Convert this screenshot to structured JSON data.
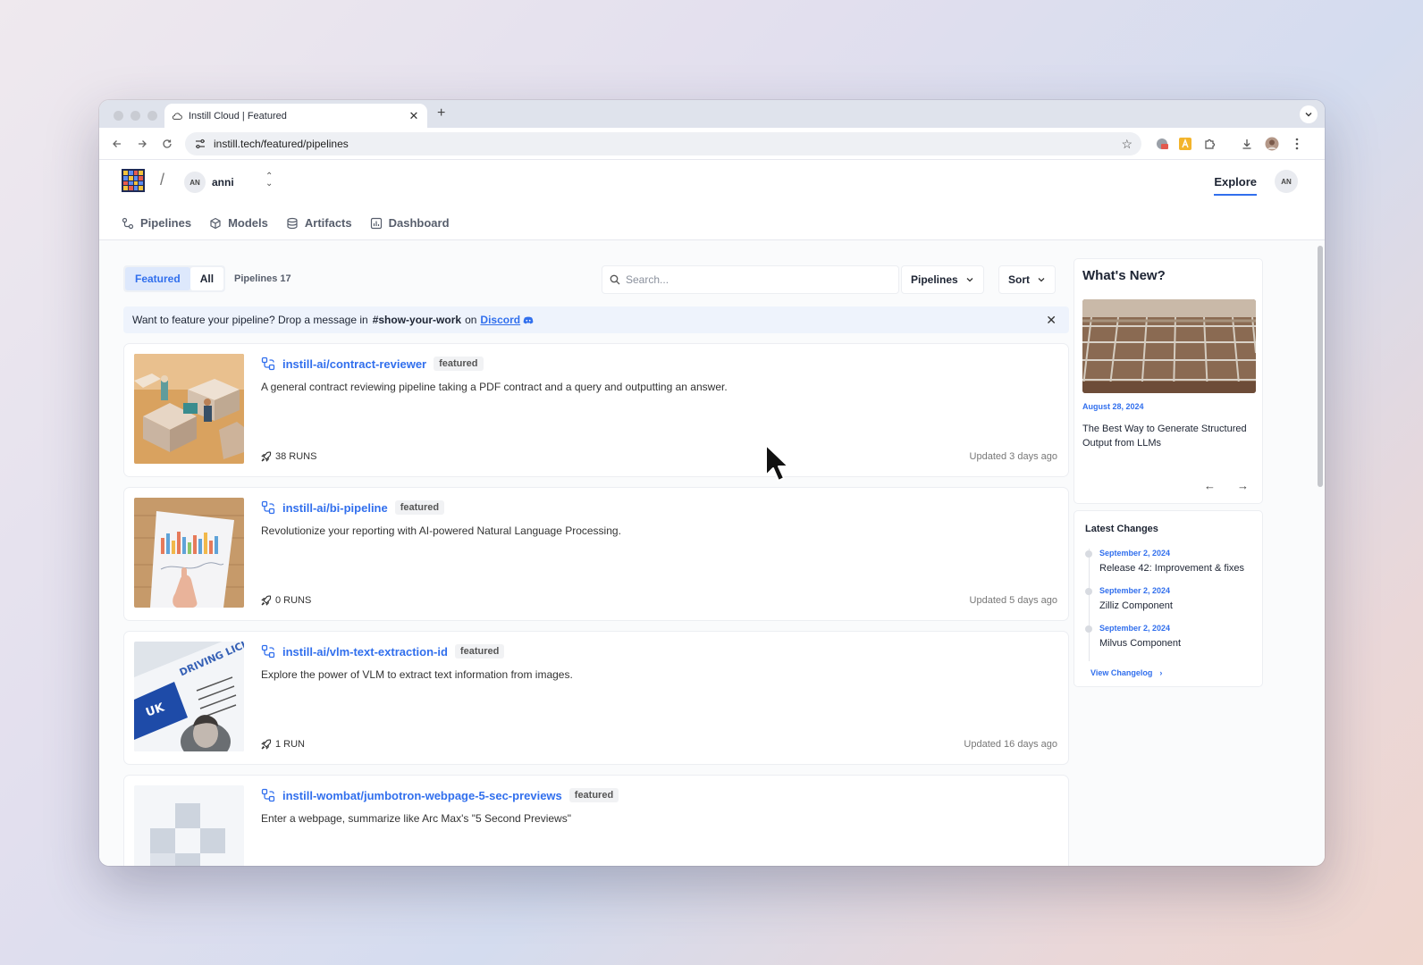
{
  "browser": {
    "tab_title": "Instill Cloud | Featured",
    "url": "instill.tech/featured/pipelines"
  },
  "header": {
    "namespace_initials": "AN",
    "namespace_name": "anni",
    "explore_label": "Explore",
    "user_initials": "AN"
  },
  "nav": {
    "pipelines": "Pipelines",
    "models": "Models",
    "artifacts": "Artifacts",
    "dashboard": "Dashboard"
  },
  "filters": {
    "featured": "Featured",
    "all": "All",
    "count_label": "Pipelines 17",
    "search_placeholder": "Search...",
    "type_dropdown": "Pipelines",
    "sort_dropdown": "Sort"
  },
  "banner": {
    "text": "Want to feature your pipeline? Drop a message in",
    "channel": "#show-your-work",
    "on": "on",
    "link": "Discord"
  },
  "pipelines": [
    {
      "name": "instill-ai/contract-reviewer",
      "badge": "featured",
      "description": "A general contract reviewing pipeline taking a PDF contract and a query and outputting an answer.",
      "runs": "38 RUNS",
      "updated": "Updated 3 days ago"
    },
    {
      "name": "instill-ai/bi-pipeline",
      "badge": "featured",
      "description": "Revolutionize your reporting with AI-powered Natural Language Processing.",
      "runs": "0 RUNS",
      "updated": "Updated 5 days ago"
    },
    {
      "name": "instill-ai/vlm-text-extraction-id",
      "badge": "featured",
      "description": "Explore the power of VLM to extract text information from images.",
      "runs": "1 RUN",
      "updated": "Updated 16 days ago"
    },
    {
      "name": "instill-wombat/jumbotron-webpage-5-sec-previews",
      "badge": "featured",
      "description": "Enter a webpage, summarize like Arc Max's \"5 Second Previews\"",
      "runs": "",
      "updated": ""
    }
  ],
  "whats_new": {
    "heading": "What's New?",
    "date": "August 28, 2024",
    "title": "The Best Way to Generate Structured Output from LLMs"
  },
  "latest_changes": {
    "heading": "Latest Changes",
    "items": [
      {
        "date": "September 2, 2024",
        "title": "Release 42: Improvement & fixes"
      },
      {
        "date": "September 2, 2024",
        "title": "Zilliz Component"
      },
      {
        "date": "September 2, 2024",
        "title": "Milvus Component"
      }
    ],
    "view_changelog": "View Changelog"
  },
  "thumb_text": {
    "license_title": "DRIVING LICE",
    "country": "UK"
  },
  "colors": {
    "accent": "#316fed",
    "text": "#1d2433"
  }
}
